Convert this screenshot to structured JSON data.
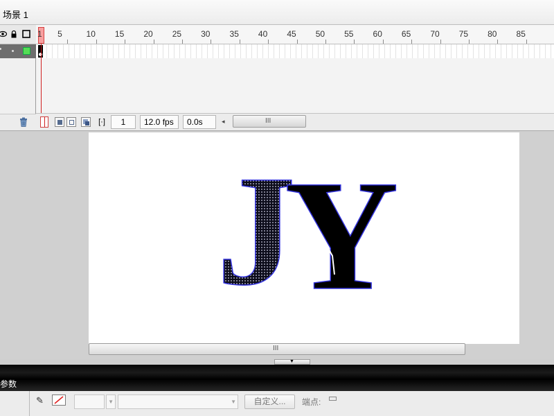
{
  "scene": {
    "title": "场景 1"
  },
  "timeline": {
    "header_icons": [
      "eye-icon",
      "lock-icon",
      "outline-icon"
    ],
    "ruler_ticks": [
      "1",
      "5",
      "10",
      "15",
      "20",
      "25",
      "30",
      "35",
      "40",
      "45",
      "50",
      "55",
      "60",
      "65",
      "70",
      "75",
      "80",
      "85"
    ],
    "current_frame": "1",
    "frame_rate": "12.0 fps",
    "elapsed_time": "0.0s",
    "scroll_grip": "III",
    "scroll_left_arrow": "◂"
  },
  "stage": {
    "text": "JY",
    "scroll_grip": "III"
  },
  "properties": {
    "title": "参数",
    "custom_button": "自定义...",
    "cap_label": "端点:"
  },
  "colors": {
    "playhead": "#d02020",
    "layer_color_box": "#55dd55",
    "letter_outline": "#3333dd"
  }
}
